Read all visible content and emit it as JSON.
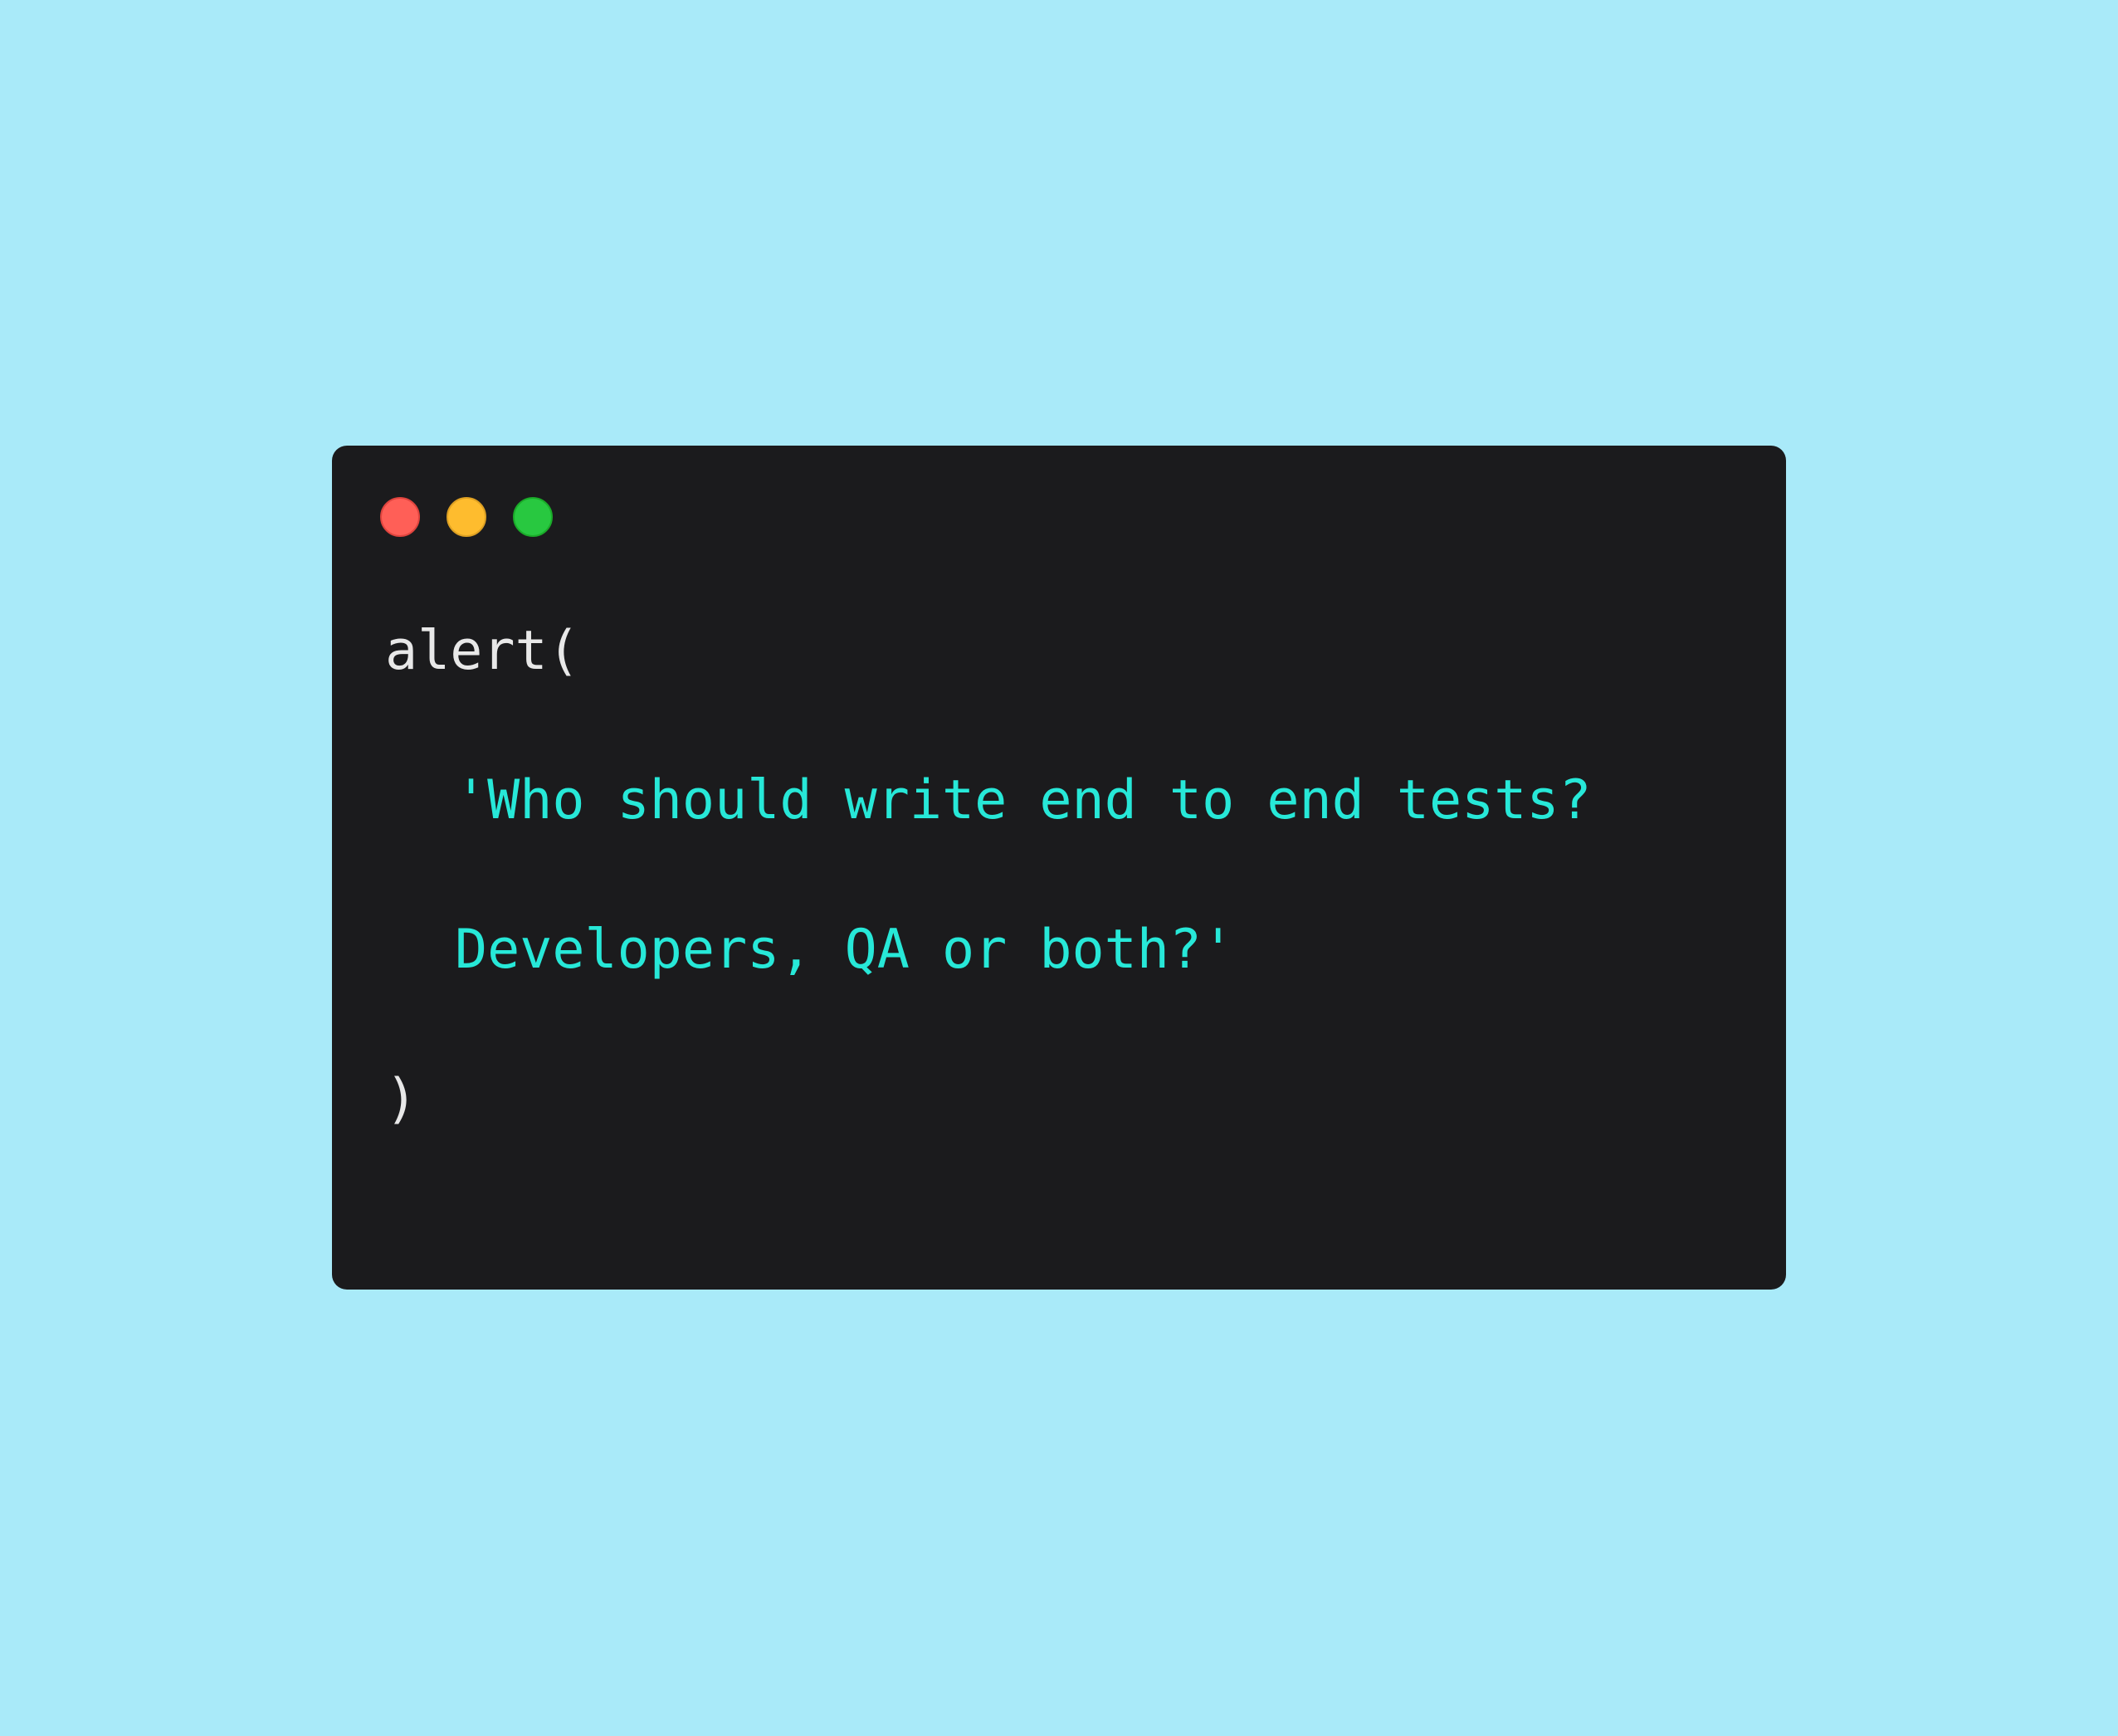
{
  "window": {
    "traffic_lights": {
      "close_color": "#ff5f57",
      "minimize_color": "#febc2e",
      "maximize_color": "#28c840"
    }
  },
  "code": {
    "line_1": "alert(",
    "line_2": "'Who should write end to end tests?",
    "line_3": "Developers, QA or both?'",
    "line_4": ")"
  },
  "colors": {
    "background": "#a9eaf9",
    "editor_background": "#1b1b1d",
    "plain_text": "#e8e8e8",
    "string_text": "#27e8d8"
  }
}
